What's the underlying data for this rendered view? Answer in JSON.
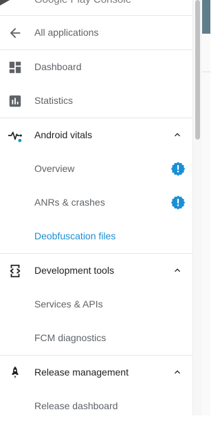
{
  "app": {
    "title": "Google Play Console"
  },
  "nav": {
    "back": {
      "label": "All applications",
      "icon": "arrow-left-icon"
    },
    "dashboard": {
      "label": "Dashboard",
      "icon": "dashboard-icon"
    },
    "statistics": {
      "label": "Statistics",
      "icon": "bar-chart-icon"
    },
    "android_vitals": {
      "label": "Android vitals",
      "icon": "vitals-pulse-icon",
      "expanded": true,
      "children": [
        {
          "label": "Overview",
          "alert": true
        },
        {
          "label": "ANRs & crashes",
          "alert": true
        },
        {
          "label": "Deobfuscation files",
          "active": true
        }
      ]
    },
    "development_tools": {
      "label": "Development tools",
      "icon": "dev-tools-icon",
      "expanded": true,
      "children": [
        {
          "label": "Services & APIs"
        },
        {
          "label": "FCM diagnostics"
        }
      ]
    },
    "release_management": {
      "label": "Release management",
      "icon": "rocket-icon",
      "expanded": true,
      "children": [
        {
          "label": "Release dashboard"
        }
      ]
    }
  },
  "colors": {
    "accent": "#1a8fd6",
    "alert_badge": "#1a8fd6",
    "text_primary": "#202124",
    "text_secondary": "#5f6368",
    "icon": "#5f6368"
  }
}
